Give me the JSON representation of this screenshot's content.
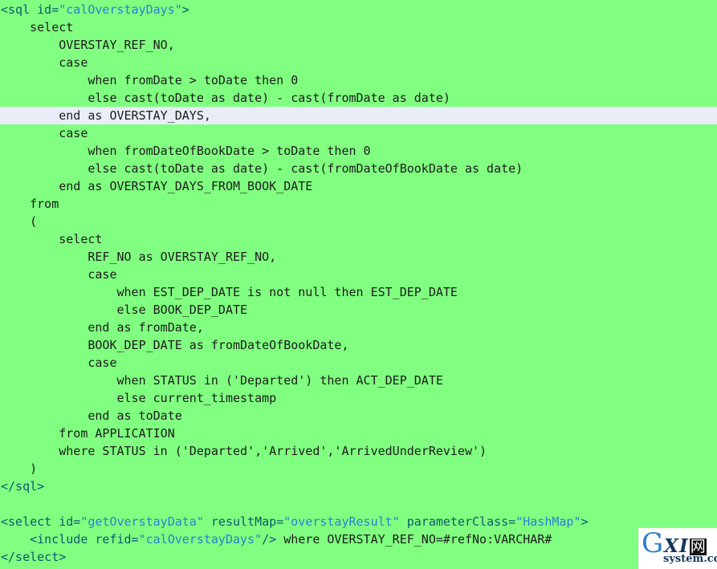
{
  "editor": {
    "background_color": "#80ff80",
    "current_line_bg": "#e9edf8",
    "tag_color": "#0b5a6b",
    "attr_value_color": "#2b7fd4",
    "text_color": "#1a1a1a",
    "current_line_index": 6
  },
  "lines": [
    {
      "indent": 0,
      "segments": [
        {
          "style": "tag",
          "text": "<sql id="
        },
        {
          "style": "attrval",
          "text": "\"calOverstayDays\""
        },
        {
          "style": "tag",
          "text": ">"
        }
      ]
    },
    {
      "indent": 0,
      "segments": [
        {
          "style": "plain",
          "text": "    select"
        }
      ]
    },
    {
      "indent": 0,
      "segments": [
        {
          "style": "plain",
          "text": "        OVERSTAY_REF_NO,"
        }
      ]
    },
    {
      "indent": 0,
      "segments": [
        {
          "style": "plain",
          "text": "        case"
        }
      ]
    },
    {
      "indent": 0,
      "segments": [
        {
          "style": "plain",
          "text": "            when fromDate > toDate then 0"
        }
      ]
    },
    {
      "indent": 0,
      "segments": [
        {
          "style": "plain",
          "text": "            else cast(toDate as date) - cast(fromDate as date)"
        }
      ]
    },
    {
      "indent": 0,
      "segments": [
        {
          "style": "plain",
          "text": "        end as OVERSTAY_DAYS,"
        }
      ]
    },
    {
      "indent": 0,
      "segments": [
        {
          "style": "plain",
          "text": "        case"
        }
      ]
    },
    {
      "indent": 0,
      "segments": [
        {
          "style": "plain",
          "text": "            when fromDateOfBookDate > toDate then 0"
        }
      ]
    },
    {
      "indent": 0,
      "segments": [
        {
          "style": "plain",
          "text": "            else cast(toDate as date) - cast(fromDateOfBookDate as date)"
        }
      ]
    },
    {
      "indent": 0,
      "segments": [
        {
          "style": "plain",
          "text": "        end as OVERSTAY_DAYS_FROM_BOOK_DATE"
        }
      ]
    },
    {
      "indent": 0,
      "segments": [
        {
          "style": "plain",
          "text": "    from"
        }
      ]
    },
    {
      "indent": 0,
      "segments": [
        {
          "style": "plain",
          "text": "    ("
        }
      ]
    },
    {
      "indent": 0,
      "segments": [
        {
          "style": "plain",
          "text": "        select"
        }
      ]
    },
    {
      "indent": 0,
      "segments": [
        {
          "style": "plain",
          "text": "            REF_NO as OVERSTAY_REF_NO,"
        }
      ]
    },
    {
      "indent": 0,
      "segments": [
        {
          "style": "plain",
          "text": "            case"
        }
      ]
    },
    {
      "indent": 0,
      "segments": [
        {
          "style": "plain",
          "text": "                when EST_DEP_DATE is not null then EST_DEP_DATE"
        }
      ]
    },
    {
      "indent": 0,
      "segments": [
        {
          "style": "plain",
          "text": "                else BOOK_DEP_DATE"
        }
      ]
    },
    {
      "indent": 0,
      "segments": [
        {
          "style": "plain",
          "text": "            end as fromDate,"
        }
      ]
    },
    {
      "indent": 0,
      "segments": [
        {
          "style": "plain",
          "text": "            BOOK_DEP_DATE as fromDateOfBookDate,"
        }
      ]
    },
    {
      "indent": 0,
      "segments": [
        {
          "style": "plain",
          "text": "            case"
        }
      ]
    },
    {
      "indent": 0,
      "segments": [
        {
          "style": "plain",
          "text": "                when STATUS in ('Departed') then ACT_DEP_DATE"
        }
      ]
    },
    {
      "indent": 0,
      "segments": [
        {
          "style": "plain",
          "text": "                else current_timestamp"
        }
      ]
    },
    {
      "indent": 0,
      "segments": [
        {
          "style": "plain",
          "text": "            end as toDate"
        }
      ]
    },
    {
      "indent": 0,
      "segments": [
        {
          "style": "plain",
          "text": "        from APPLICATION"
        }
      ]
    },
    {
      "indent": 0,
      "segments": [
        {
          "style": "plain",
          "text": "        where STATUS in ('Departed','Arrived','ArrivedUnderReview')"
        }
      ]
    },
    {
      "indent": 0,
      "segments": [
        {
          "style": "plain",
          "text": "    )"
        }
      ]
    },
    {
      "indent": 0,
      "segments": [
        {
          "style": "tag",
          "text": "</sql>"
        }
      ]
    },
    {
      "indent": 0,
      "segments": [
        {
          "style": "plain",
          "text": ""
        }
      ]
    },
    {
      "indent": 0,
      "segments": [
        {
          "style": "tag",
          "text": "<select id="
        },
        {
          "style": "attrval",
          "text": "\"getOverstayData\""
        },
        {
          "style": "tag",
          "text": " resultMap="
        },
        {
          "style": "attrval",
          "text": "\"overstayResult\""
        },
        {
          "style": "tag",
          "text": " parameterClass="
        },
        {
          "style": "attrval",
          "text": "\"HashMap\""
        },
        {
          "style": "tag",
          "text": ">"
        }
      ]
    },
    {
      "indent": 0,
      "segments": [
        {
          "style": "plain",
          "text": "    "
        },
        {
          "style": "tag",
          "text": "<include refid="
        },
        {
          "style": "attrval",
          "text": "\"calOverstayDays\""
        },
        {
          "style": "tag",
          "text": "/>"
        },
        {
          "style": "plain",
          "text": " where OVERSTAY_REF_NO=#refNo:VARCHAR#"
        }
      ]
    },
    {
      "indent": 0,
      "segments": [
        {
          "style": "tag",
          "text": "</select>"
        }
      ]
    }
  ],
  "watermark": {
    "letter_g": "G",
    "letters_xi": "XI",
    "cjk_char": "网",
    "domain": "system.com",
    "g_color": "#2f7fc8",
    "xi_color": "#15365c"
  }
}
